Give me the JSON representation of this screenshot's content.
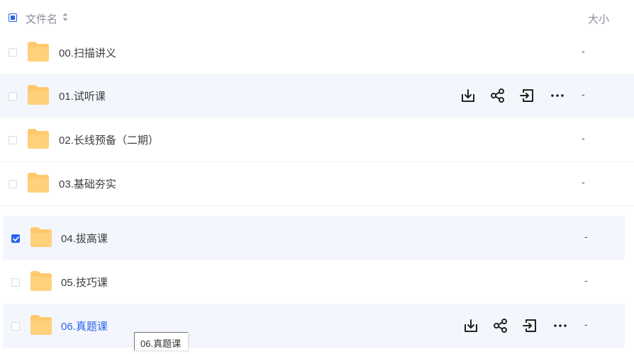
{
  "header": {
    "name_label": "文件名",
    "size_label": "大小"
  },
  "rows": [
    {
      "name": "00.扫描讲义",
      "size": "-"
    },
    {
      "name": "01.试听课",
      "size": "-"
    },
    {
      "name": "02.长线预备（二期）",
      "size": "-"
    },
    {
      "name": "03.基础夯实",
      "size": "-"
    },
    {
      "name": "04.拔高课",
      "size": "-",
      "checked": true
    },
    {
      "name": "05.技巧课",
      "size": "-"
    },
    {
      "name": "06.真题课",
      "size": "-"
    }
  ],
  "actions": [
    "download-icon",
    "share-icon",
    "move-icon",
    "more-icon"
  ],
  "tooltip": "06.真题课",
  "colors": {
    "accent": "#2b63ea",
    "folder": "#ffc96b",
    "hover_bg": "#f4f6fd"
  }
}
